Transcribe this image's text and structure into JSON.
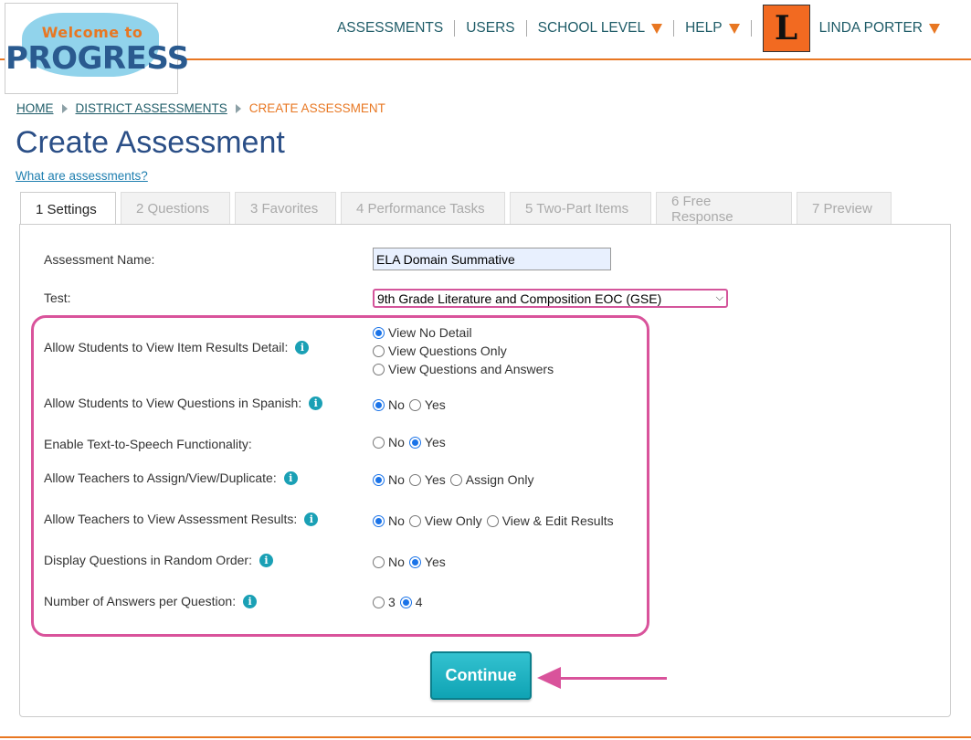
{
  "logo": {
    "welcome": "Welcome to",
    "progress": "PROGRESS"
  },
  "nav": {
    "assessments": "ASSESSMENTS",
    "users": "USERS",
    "school_level": "SCHOOL LEVEL",
    "help": "HELP",
    "avatar_letter": "L",
    "user_name": "LINDA PORTER"
  },
  "breadcrumb": {
    "home": "HOME",
    "district": "DISTRICT ASSESSMENTS",
    "current": "CREATE ASSESSMENT"
  },
  "page": {
    "title": "Create Assessment",
    "help_link": "What are assessments?"
  },
  "tabs": [
    {
      "label": "1 Settings"
    },
    {
      "label": "2 Questions"
    },
    {
      "label": "3 Favorites"
    },
    {
      "label": "4 Performance Tasks"
    },
    {
      "label": "5 Two-Part Items"
    },
    {
      "label": "6 Free Response"
    },
    {
      "label": "7 Preview"
    }
  ],
  "form": {
    "name_label": "Assessment Name:",
    "name_value": "ELA Domain Summative",
    "test_label": "Test:",
    "test_value": "9th Grade Literature and Composition EOC (GSE)",
    "item_results": {
      "label": "Allow Students to View Item Results Detail:",
      "options": [
        "View No Detail",
        "View Questions Only",
        "View Questions and Answers"
      ]
    },
    "spanish": {
      "label": "Allow Students to View Questions in Spanish:",
      "options": [
        "No",
        "Yes"
      ]
    },
    "tts": {
      "label": "Enable Text-to-Speech Functionality:",
      "options": [
        "No",
        "Yes"
      ]
    },
    "teachers_assign": {
      "label": "Allow Teachers to Assign/View/Duplicate:",
      "options": [
        "No",
        "Yes",
        "Assign Only"
      ]
    },
    "teachers_results": {
      "label": "Allow Teachers to View Assessment Results:",
      "options": [
        "No",
        "View Only",
        "View & Edit Results"
      ]
    },
    "random": {
      "label": "Display Questions in Random Order:",
      "options": [
        "No",
        "Yes"
      ]
    },
    "answers": {
      "label": "Number of Answers per Question:",
      "options": [
        "3",
        "4"
      ]
    },
    "info_glyph": "i"
  },
  "continue_label": "Continue",
  "colors": {
    "accent": "#e87722",
    "teal": "#1aa0b5",
    "highlight": "#d9539b",
    "title": "#2b4f87"
  }
}
